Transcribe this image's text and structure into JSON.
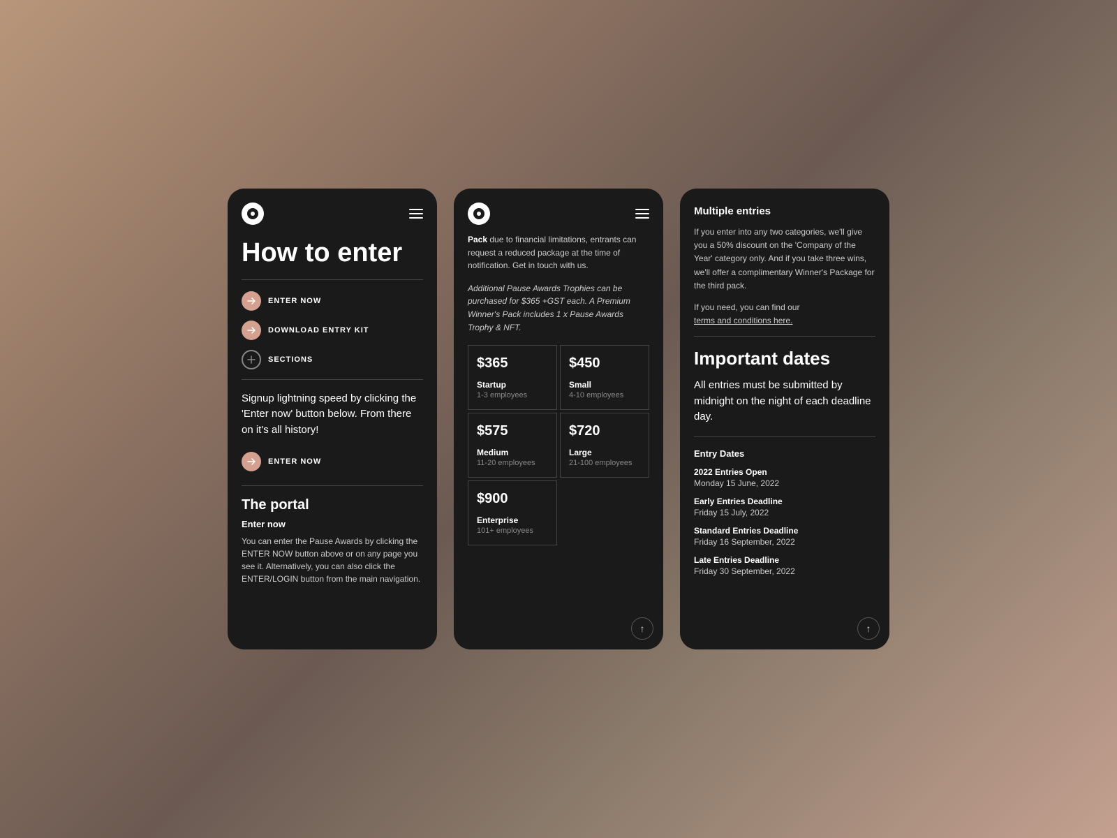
{
  "background": {
    "gradient": "linear-gradient(135deg, #b8967a, #8a7060, #6b5a52, #8a7a6a, #c4a090)"
  },
  "phone1": {
    "logo_alt": "Pause Awards Logo",
    "menu_label": "Menu",
    "page_title": "How to enter",
    "nav_items": [
      {
        "label": "ENTER NOW",
        "type": "arrow"
      },
      {
        "label": "DOWNLOAD ENTRY KIT",
        "type": "arrow"
      },
      {
        "label": "SECTIONS",
        "type": "plus"
      }
    ],
    "body_text": "Signup lightning speed by clicking the 'Enter now' button below. From there on it's all history!",
    "enter_now_label": "ENTER NOW",
    "portal_section": {
      "title": "The portal",
      "enter_now_sub": "Enter now",
      "description": "You can enter the Pause Awards by clicking the ENTER NOW button above or on any page you see it. Alternatively, you can also click the ENTER/LOGIN button from the main navigation."
    }
  },
  "phone2": {
    "logo_alt": "Pause Awards Logo",
    "menu_label": "Menu",
    "pack_text_bold": "Pack",
    "pack_text": " due to financial limitations, entrants can request a reduced package at the time of notification. Get in touch with us.",
    "italic_text": "Additional Pause Awards Trophies can be purchased for $365 +GST each. A Premium Winner's Pack includes 1 x Pause Awards Trophy & NFT.",
    "pricing": [
      {
        "amount": "$365",
        "tier": "Startup",
        "employees": "1-3 employees"
      },
      {
        "amount": "$450",
        "tier": "Small",
        "employees": "4-10 employees"
      },
      {
        "amount": "$575",
        "tier": "Medium",
        "employees": "11-20 employees"
      },
      {
        "amount": "$720",
        "tier": "Large",
        "employees": "21-100 employees"
      },
      {
        "amount": "$900",
        "tier": "Enterprise",
        "employees": "101+ employees"
      }
    ],
    "scroll_up_label": "↑"
  },
  "phone3": {
    "multiple_entries_title": "Multiple entries",
    "multiple_entries_body": "If you enter into any two categories, we'll give you a 50% discount on the 'Company of the Year' category only. And if you take three wins, we'll offer a complimentary Winner's Package for the third pack.",
    "tc_text": "If you need, you can find our",
    "tc_link": "terms and conditions here.",
    "important_dates_title": "Important dates",
    "important_dates_body": "All entries must be submitted by midnight on the night of each deadline day.",
    "entry_dates_label": "Entry Dates",
    "dates": [
      {
        "title": "2022 Entries Open",
        "date": "Monday 15 June, 2022"
      },
      {
        "title": "Early Entries Deadline",
        "date": "Friday 15 July, 2022"
      },
      {
        "title": "Standard Entries Deadline",
        "date": "Friday 16 September, 2022"
      },
      {
        "title": "Late Entries Deadline",
        "date": "Friday 30 September, 2022"
      }
    ],
    "scroll_up_label": "↑"
  }
}
